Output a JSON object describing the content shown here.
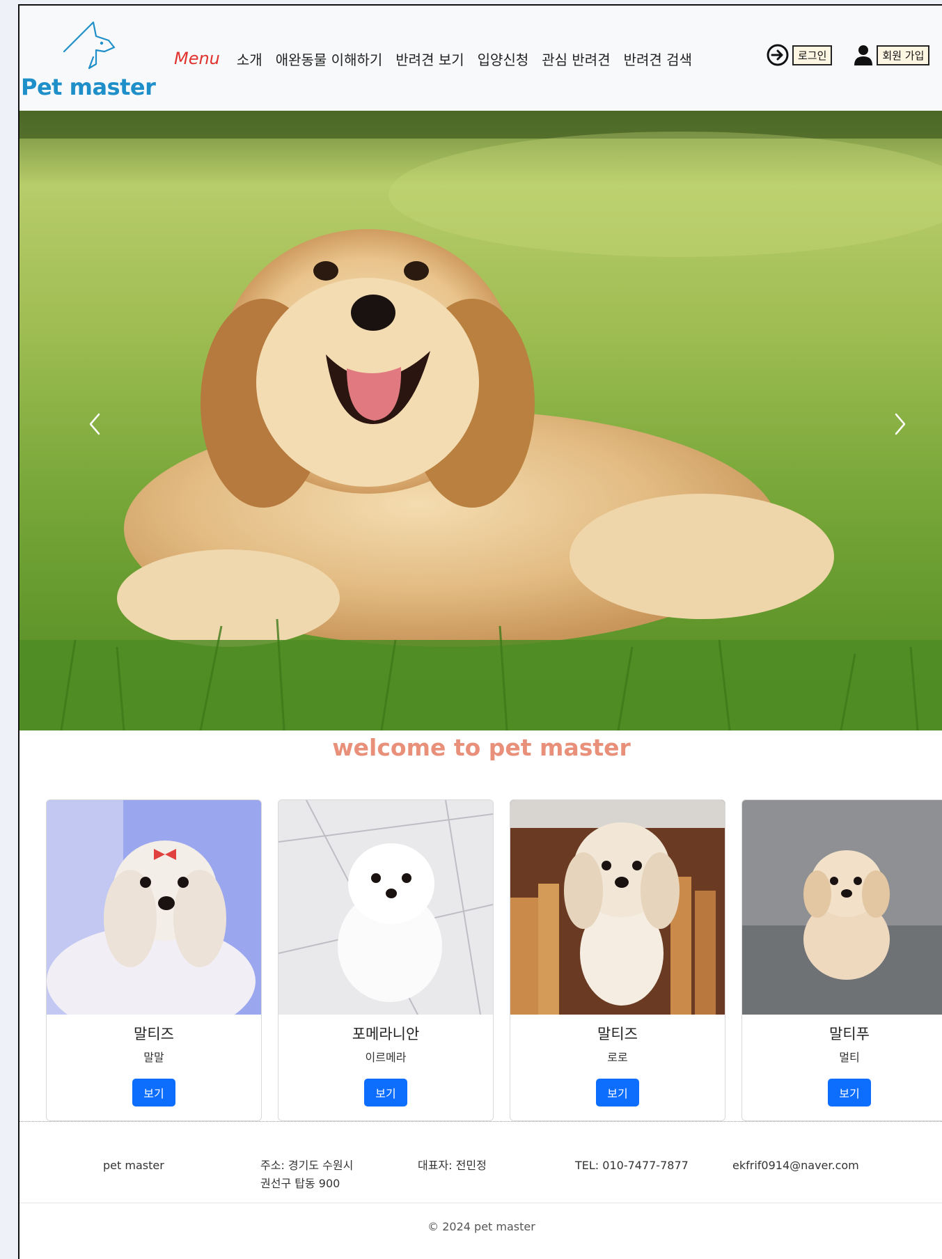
{
  "header": {
    "logo_text": "Pet master",
    "menu_label": "Menu",
    "nav": [
      "소개",
      "애완동물 이해하기",
      "반려견 보기",
      "입양신청",
      "관심 반려견",
      "반려견 검색"
    ],
    "login_label": "로그인",
    "signup_label": "회원 가입"
  },
  "hero": {
    "prev_icon": "chevron-left",
    "next_icon": "chevron-right"
  },
  "welcome": "welcome to pet master",
  "cards": [
    {
      "breed": "말티즈",
      "name": "말말",
      "button": "보기"
    },
    {
      "breed": "포메라니안",
      "name": "이르메라",
      "button": "보기"
    },
    {
      "breed": "말티즈",
      "name": "로로",
      "button": "보기"
    },
    {
      "breed": "말티푸",
      "name": "멀티",
      "button": "보기"
    }
  ],
  "footer": {
    "brand": "pet master",
    "address_line1": "주소: 경기도 수원시",
    "address_line2": "권선구 탑동 900",
    "representative": "대표자: 전민정",
    "tel": "TEL: 010-7477-7877",
    "email": "ekfrif0914@naver.com",
    "copyright": "© 2024 pet master"
  },
  "colors": {
    "brand": "#1e8fc9",
    "menu": "#e0332e",
    "welcome": "#e8907a",
    "button": "#0d6efd"
  }
}
